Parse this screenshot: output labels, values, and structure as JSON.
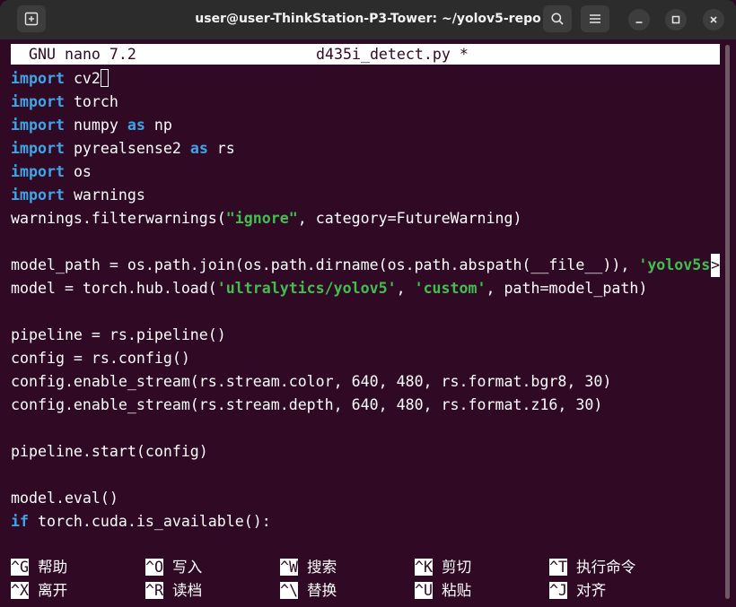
{
  "window": {
    "title": "user@user-ThinkStation-P3-Tower: ~/yolov5-repo"
  },
  "nano": {
    "version": "GNU nano 7.2",
    "filename": "d435i_detect.py *"
  },
  "code_lines": [
    [
      {
        "t": "import",
        "k": "kw"
      },
      {
        "t": " cv2"
      }
    ],
    [
      {
        "t": "import",
        "k": "kw"
      },
      {
        "t": " torch"
      }
    ],
    [
      {
        "t": "import",
        "k": "kw"
      },
      {
        "t": " numpy "
      },
      {
        "t": "as",
        "k": "kw"
      },
      {
        "t": " np"
      }
    ],
    [
      {
        "t": "import",
        "k": "kw"
      },
      {
        "t": " pyrealsense2 "
      },
      {
        "t": "as",
        "k": "kw"
      },
      {
        "t": " rs"
      }
    ],
    [
      {
        "t": "import",
        "k": "kw"
      },
      {
        "t": " os"
      }
    ],
    [
      {
        "t": "import",
        "k": "kw"
      },
      {
        "t": " warnings"
      }
    ],
    [
      {
        "t": "warnings.filterwarnings("
      },
      {
        "t": "\"ignore\"",
        "k": "str"
      },
      {
        "t": ", category=FutureWarning)"
      }
    ],
    [],
    [
      {
        "t": "model_path = os.path.join(os.path.dirname(os.path.abspath(__file__)), "
      },
      {
        "t": "'yolov5s",
        "k": "str"
      }
    ],
    [
      {
        "t": "model = torch.hub.load("
      },
      {
        "t": "'ultralytics/yolov5'",
        "k": "str"
      },
      {
        "t": ", "
      },
      {
        "t": "'custom'",
        "k": "str"
      },
      {
        "t": ", path=model_path)"
      }
    ],
    [],
    [
      {
        "t": "pipeline = rs.pipeline()"
      }
    ],
    [
      {
        "t": "config = rs.config()"
      }
    ],
    [
      {
        "t": "config.enable_stream(rs.stream.color, 640, 480, rs.format.bgr8, 30)"
      }
    ],
    [
      {
        "t": "config.enable_stream(rs.stream.depth, 640, 480, rs.format.z16, 30)"
      }
    ],
    [],
    [
      {
        "t": "pipeline.start(config)"
      }
    ],
    [],
    [
      {
        "t": "model.eval()"
      }
    ],
    [
      {
        "t": "if",
        "k": "kw"
      },
      {
        "t": " torch.cuda.is_available():"
      }
    ]
  ],
  "continuation_marker": ">",
  "shortcuts": {
    "row1": [
      {
        "key": "^G",
        "label": "帮助"
      },
      {
        "key": "^O",
        "label": "写入"
      },
      {
        "key": "^W",
        "label": "搜索"
      },
      {
        "key": "^K",
        "label": "剪切"
      },
      {
        "key": "^T",
        "label": "执行命令"
      }
    ],
    "row2": [
      {
        "key": "^X",
        "label": "离开"
      },
      {
        "key": "^R",
        "label": "读档"
      },
      {
        "key": "^\\",
        "label": "替换"
      },
      {
        "key": "^U",
        "label": "粘贴"
      },
      {
        "key": "^J",
        "label": "对齐"
      }
    ]
  },
  "colors": {
    "terminal_bg": "#300a24",
    "keyword": "#3da5e8",
    "string": "#40bf4f"
  },
  "icons": {
    "new_tab": "new-tab-icon",
    "search": "search-icon",
    "menu": "hamburger-menu-icon",
    "minimize": "minimize-icon",
    "maximize": "maximize-icon",
    "close": "close-icon"
  }
}
